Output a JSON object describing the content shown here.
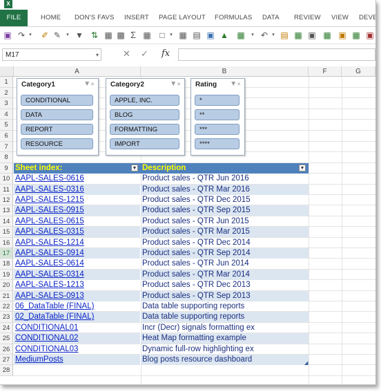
{
  "ribbon": {
    "tabs": [
      "FILE",
      "HOME",
      "DON'S FAVS",
      "INSERT",
      "PAGE LAYOUT",
      "FORMULAS",
      "DATA",
      "REVIEW",
      "VIEW",
      "DEVE"
    ]
  },
  "formula_bar": {
    "name_box": "M17",
    "fx_label": "fx"
  },
  "columns": [
    "A",
    "B",
    "F",
    "G"
  ],
  "rows": [
    "1",
    "2",
    "3",
    "4",
    "5",
    "6",
    "7",
    "8",
    "9",
    "10",
    "11",
    "12",
    "13",
    "14",
    "15",
    "16",
    "17",
    "18",
    "19",
    "20",
    "21",
    "22",
    "23",
    "24",
    "25",
    "26",
    "27",
    "28"
  ],
  "slicers": [
    {
      "title": "Category1",
      "items": [
        "CONDITIONAL",
        "DATA",
        "REPORT",
        "RESOURCE"
      ]
    },
    {
      "title": "Category2",
      "items": [
        "APPLE, INC.",
        "BLOG",
        "FORMATTING",
        "IMPORT"
      ]
    },
    {
      "title": "Rating",
      "items": [
        "*",
        "**",
        "***",
        "****"
      ]
    }
  ],
  "table": {
    "headers": [
      "Sheet index:",
      "Description"
    ],
    "rows": [
      [
        "AAPL-SALES-0616",
        "Product sales - QTR Jun 2016"
      ],
      [
        "AAPL-SALES-0316",
        "Product sales - QTR Mar 2016"
      ],
      [
        "AAPL-SALES-1215",
        "Product sales - QTR Dec 2015"
      ],
      [
        "AAPL-SALES-0915",
        "Product sales - QTR Sep 2015"
      ],
      [
        "AAPL-SALES-0615",
        "Product sales - QTR Jun 2015"
      ],
      [
        "AAPL-SALES-0315",
        "Product sales - QTR Mar 2015"
      ],
      [
        "AAPL-SALES-1214",
        "Product sales - QTR Dec 2014"
      ],
      [
        "AAPL-SALES-0914",
        "Product sales - QTR Sep 2014"
      ],
      [
        "AAPL-SALES-0614",
        "Product sales - QTR Jun 2014"
      ],
      [
        "AAPL-SALES-0314",
        "Product sales - QTR Mar 2014"
      ],
      [
        "AAPL-SALES-1213",
        "Product sales - QTR Dec 2013"
      ],
      [
        "AAPL-SALES-0913",
        "Product sales - QTR Sep 2013"
      ],
      [
        "06_DataTable (FINAL)",
        "Data table supporting reports"
      ],
      [
        "02_DataTable (FINAL)",
        "Data table supporting reports"
      ],
      [
        "CONDITIONAL01",
        "Incr (Decr) signals formatting ex"
      ],
      [
        "CONDITIONAL02",
        "Heat Map formatting example"
      ],
      [
        "CONDITIONAL03",
        "Dynamic full-row highlighting ex"
      ],
      [
        "MediumPosts",
        "Blog posts resource dashboard"
      ]
    ]
  },
  "colors": {
    "file_tab": "#217346",
    "table_header": "#4f81bd",
    "table_header_text": "#ffff00",
    "band": "#dce6f1",
    "slicer_button": "#b8cce4",
    "link": "#0b24c7"
  }
}
